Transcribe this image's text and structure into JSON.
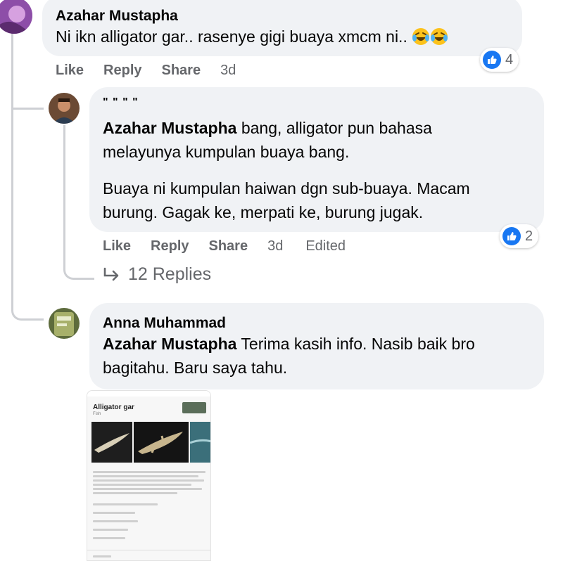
{
  "comments": [
    {
      "author": "Azahar Mustapha",
      "text": "Ni ikn alligator gar.. rasenye gigi buaya xmcm ni..",
      "emojis": [
        "rolling-on-floor-laughing",
        "rolling-on-floor-laughing"
      ],
      "actions": {
        "like": "Like",
        "reply": "Reply",
        "share": "Share"
      },
      "time": "3d",
      "reaction_count": "4"
    },
    {
      "author": "\" \" \" \"",
      "mention": "Azahar Mustapha",
      "text_line1": " bang, alligator pun bahasa",
      "text_line2": "melayunya kumpulan buaya bang.",
      "para2_line1": "Buaya ni kumpulan haiwan dgn sub-buaya. Macam",
      "para2_line2": "burung. Gagak ke, merpati ke, burung jugak.",
      "actions": {
        "like": "Like",
        "reply": "Reply",
        "share": "Share"
      },
      "time": "3d",
      "edited": "Edited",
      "reaction_count": "2",
      "replies": "12 Replies"
    },
    {
      "author": "Anna Muhammad",
      "mention": "Azahar Mustapha",
      "text_line1": " Terima kasih info. Nasib baik bro",
      "text_line2": "bagitahu. Baru saya tahu.",
      "attachment": {
        "title": "Alligator gar",
        "subtitle": "Fish"
      }
    }
  ],
  "colors": {
    "bubble": "#f0f2f5",
    "meta": "#65676b",
    "like_blue": "#1877f2",
    "thread_line": "#ced0d4"
  }
}
